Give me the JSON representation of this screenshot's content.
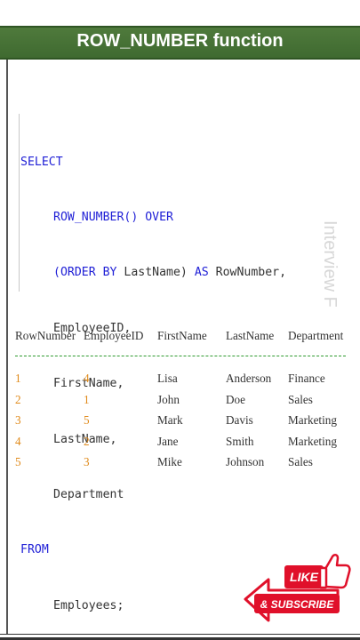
{
  "banner": {
    "title": "ROW_NUMBER function"
  },
  "code": {
    "lines": [
      {
        "kw": "SELECT",
        "rest": ""
      },
      {
        "kw": "ROW_NUMBER() OVER",
        "rest": ""
      },
      {
        "kw": "(ORDER BY",
        "rest": " LastName) ",
        "kw2": "AS",
        "rest2": " RowNumber,"
      },
      {
        "kw": "",
        "rest": "EmployeeID,"
      },
      {
        "kw": "",
        "rest": "FirstName,"
      },
      {
        "kw": "",
        "rest": "LastName,"
      },
      {
        "kw": "",
        "rest": "Department"
      },
      {
        "kw": "FROM",
        "rest": ""
      },
      {
        "kw": "",
        "rest": "Employees;"
      }
    ]
  },
  "watermark": "Interview F",
  "result": {
    "headers": [
      "RowNumber",
      "EmployeeID",
      "FirstName",
      "LastName",
      "Department"
    ],
    "rows": [
      [
        "1",
        "4",
        "Lisa",
        "Anderson",
        "Finance"
      ],
      [
        "2",
        "1",
        "John",
        "Doe",
        "Sales"
      ],
      [
        "3",
        "5",
        "Mark",
        "Davis",
        "Marketing"
      ],
      [
        "4",
        "2",
        "Jane",
        "Smith",
        "Marketing"
      ],
      [
        "5",
        "3",
        "Mike",
        "Johnson",
        "Sales"
      ]
    ]
  },
  "badge": {
    "like": "LIKE",
    "subscribe": "& SUBSCRIBE",
    "accent": "#e0102a"
  }
}
